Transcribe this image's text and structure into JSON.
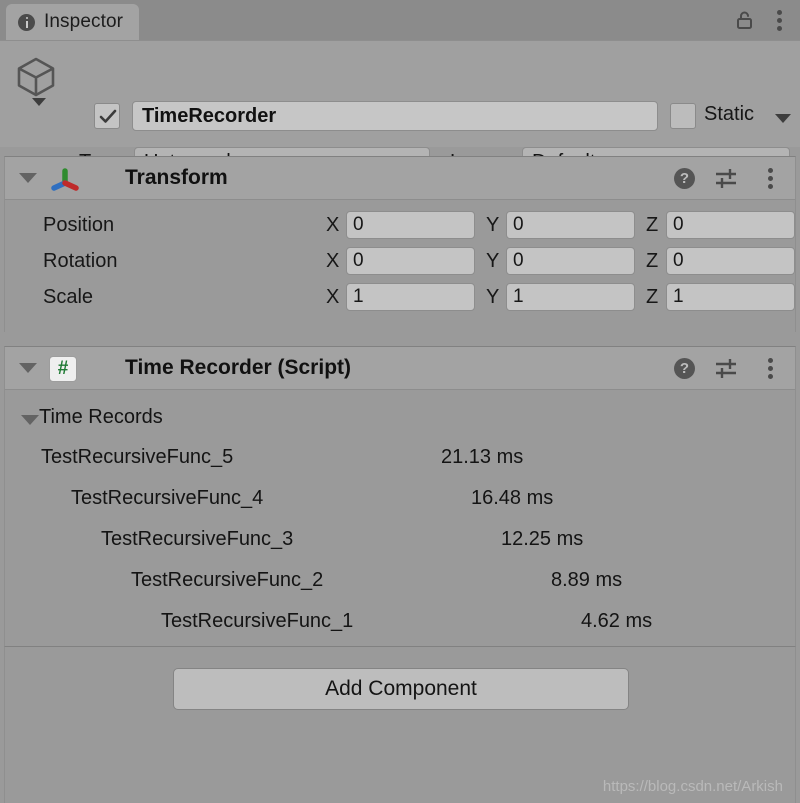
{
  "window": {
    "tab_label": "Inspector",
    "tab_icon": "info-icon",
    "lock_icon": "unlock-icon",
    "menu_icon": "kebab-menu-icon"
  },
  "object_header": {
    "icon": "cube-icon",
    "enabled_checkbox": true,
    "name": "TimeRecorder",
    "static_label": "Static",
    "static_checked": false,
    "tag_label": "Tag",
    "tag_value": "Untagged",
    "layer_label": "Layer",
    "layer_value": "Default"
  },
  "transform": {
    "title": "Transform",
    "icon": "transform-gizmo-icon",
    "expanded": true,
    "help_icon": "help-icon",
    "settings_icon": "preset-settings-icon",
    "menu_icon": "kebab-menu-icon",
    "rows": [
      {
        "label": "Position",
        "x": "0",
        "y": "0",
        "z": "0"
      },
      {
        "label": "Rotation",
        "x": "0",
        "y": "0",
        "z": "0"
      },
      {
        "label": "Scale",
        "x": "1",
        "y": "1",
        "z": "1"
      }
    ],
    "axis_labels": {
      "x": "X",
      "y": "Y",
      "z": "Z"
    }
  },
  "script_component": {
    "title": "Time Recorder (Script)",
    "icon": "csharp-script-icon",
    "icon_glyph": "#",
    "expanded": true,
    "help_icon": "help-icon",
    "settings_icon": "preset-settings-icon",
    "menu_icon": "kebab-menu-icon",
    "records_label": "Time Records",
    "records_expanded": true,
    "records": [
      {
        "name": "TestRecursiveFunc_5",
        "value": "21.13 ms",
        "indent": 0
      },
      {
        "name": "TestRecursiveFunc_4",
        "value": "16.48 ms",
        "indent": 1
      },
      {
        "name": "TestRecursiveFunc_3",
        "value": "12.25 ms",
        "indent": 2
      },
      {
        "name": "TestRecursiveFunc_2",
        "value": "8.89 ms",
        "indent": 3
      },
      {
        "name": "TestRecursiveFunc_1",
        "value": "4.62 ms",
        "indent": 4
      }
    ]
  },
  "footer": {
    "add_component_label": "Add Component",
    "watermark": "https://blog.csdn.net/Arkish"
  },
  "colors": {
    "panel_bg": "#9a9a9a",
    "header_bg": "#a3a3a3",
    "field_bg": "#c4c4c4",
    "tabbar_bg": "#8b8b8b",
    "axis_green": "#2e8b2e",
    "axis_blue": "#2f6fc0",
    "axis_red": "#bf2a2a",
    "script_green": "#1f7a34"
  }
}
